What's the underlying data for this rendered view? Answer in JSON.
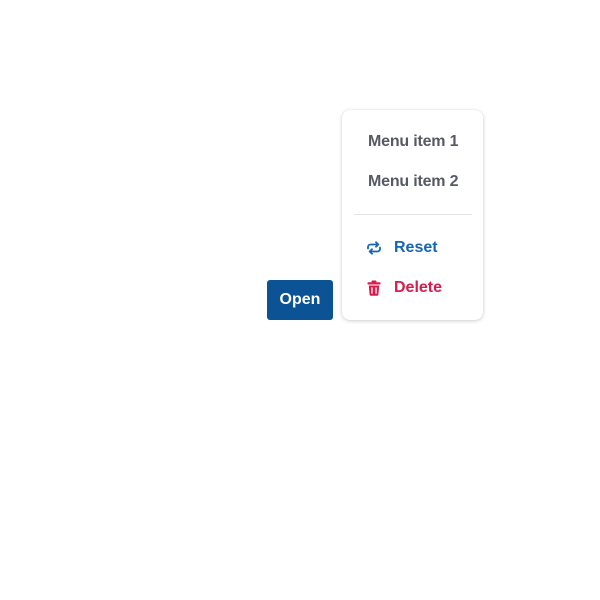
{
  "open_button": {
    "label": "Open"
  },
  "menu": {
    "items": [
      {
        "label": "Menu item 1"
      },
      {
        "label": "Menu item 2"
      }
    ],
    "actions": [
      {
        "label": "Reset",
        "icon": "reset-icon",
        "color": "#1565b8"
      },
      {
        "label": "Delete",
        "icon": "trash-icon",
        "color": "#d81b4e"
      }
    ]
  },
  "colors": {
    "primary_button": "#0b5394",
    "menu_text": "#555a66",
    "reset": "#1565b8",
    "delete": "#d81b4e"
  }
}
